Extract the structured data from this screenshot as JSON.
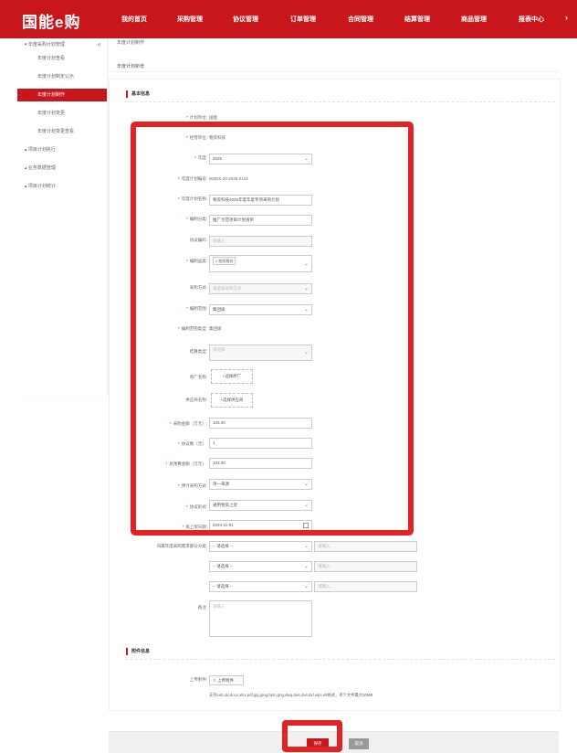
{
  "header": {
    "logo": "国能e购",
    "nav": [
      "我的首页",
      "采购管理",
      "协议管理",
      "订单管理",
      "合同管理",
      "结算管理",
      "商品管理",
      "报表中心"
    ],
    "nav_more": "›"
  },
  "sidebar": {
    "group": "年度采购计划管理",
    "collapse_icon": "«",
    "items": [
      "年度计划查看",
      "年度计划制定公示",
      "年度计划制作",
      "年度计划变更",
      "年度计划变更查看"
    ],
    "active_index": 2,
    "other_groups": [
      "项目计划执行",
      "业务数据管理",
      "项目计划统计"
    ]
  },
  "breadcrumb": "年度计划制作",
  "page_title": "年度计划新增",
  "sections": {
    "basic": "基本信息",
    "attachment": "附件信息"
  },
  "form": {
    "org_label": "计划单位:",
    "org_value": "国能",
    "dept_label": "经营单位:",
    "dept_value": "物资科技",
    "year_label": "年度:",
    "year_value": "2025",
    "plan_no_label": "年度计划编号:",
    "plan_no_value": "WZDS-20-2025-0124",
    "plan_name_label": "年度计划名称:",
    "plan_name_value": "物资科技2025年度年度专项采购计划",
    "category_label": "编制分类:",
    "category_value": "推广示范项目计划清单",
    "scope_label": "协议编码:",
    "scope_placeholder": "请输入",
    "supplier_type_label": "编制品类:",
    "supplier_type_tag": "× 物资服务",
    "subtype_label": "采购方式:",
    "subtype_value": "请选择采购方式",
    "region_label": "编制范围:",
    "region_value": "集团级",
    "contract_label": "编制范围类型:",
    "contract_value": "集团级",
    "payment_label": "结算类型:",
    "payment_value": "请选择",
    "mfr_label": "原厂名称:",
    "mfr_button": "+选择原厂",
    "supplier_label": "供应商名称:",
    "supplier_button": "+选择供应商",
    "amount_label": "采购金额（万元）:",
    "amount_value": "103.00",
    "qty_label": "协议数（元）:",
    "qty_value": "1",
    "total_label": "总预算金额（万元）:",
    "total_value": "103.00",
    "purchase_mode_label": "预计采购方式:",
    "purchase_mode_value": "单一来源",
    "agreement_label": "协议形式:",
    "agreement_value": "通用物资上架",
    "date_label": "拟上架日期:",
    "date_value": "2024-11-01",
    "resp_label": "归属年度采购需求部分分类:",
    "resp_rows": [
      {
        "select": "-- 请选择 --",
        "input": "请输入"
      },
      {
        "select": "-- 请选择 --",
        "input": "请输入"
      },
      {
        "select": "-- 请选择 --",
        "input": "请输入"
      }
    ],
    "remark_label": "备注:",
    "remark_placeholder": "请输入"
  },
  "attachment": {
    "upload_label": "上传附件:",
    "upload_button": "上传附件",
    "hint": "支持ceb,rar,docx,xlsx,pdf,jpg,jpeg,bpm,png,dwg,dws,dwt,dxf,wps,ett格式，单个文件最大50MB"
  },
  "footer": {
    "submit": "保存",
    "cancel": "取消"
  },
  "colors": {
    "brand": "#c8161d",
    "highlight": "#e32225"
  }
}
